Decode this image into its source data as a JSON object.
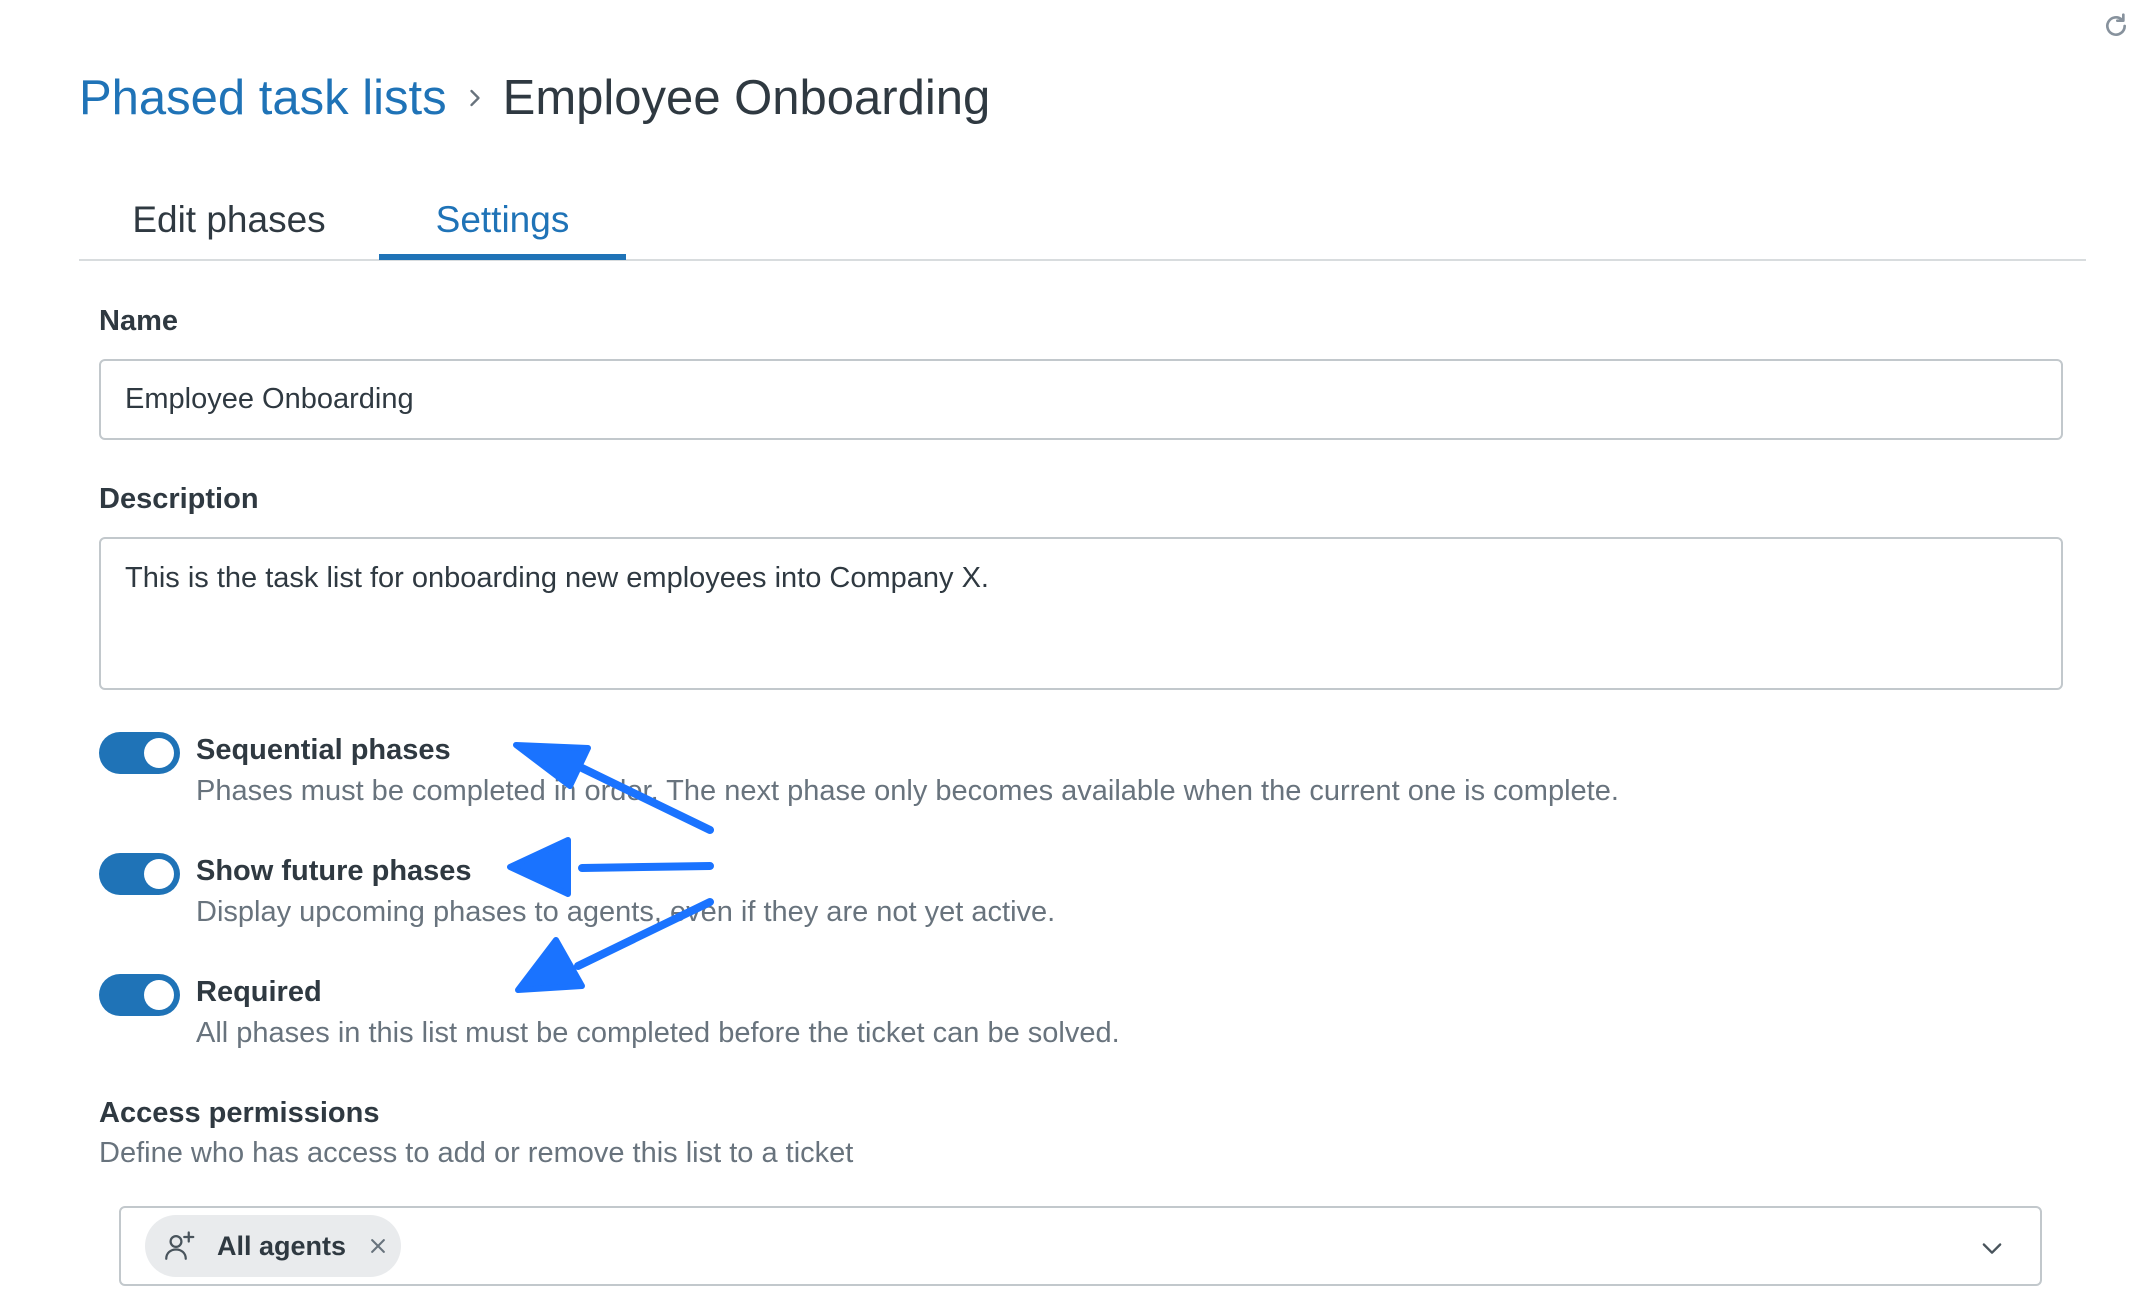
{
  "breadcrumb": {
    "parent": "Phased task lists",
    "current": "Employee Onboarding"
  },
  "tabs": [
    {
      "label": "Edit phases",
      "active": false
    },
    {
      "label": "Settings",
      "active": true
    }
  ],
  "form": {
    "name_label": "Name",
    "name_value": "Employee Onboarding",
    "description_label": "Description",
    "description_value": "This is the task list for onboarding new employees into Company X."
  },
  "toggles": [
    {
      "title": "Sequential phases",
      "description": "Phases must be completed in order. The next phase only becomes available when the current one is complete.",
      "on": true
    },
    {
      "title": "Show future phases",
      "description": "Display upcoming phases to agents, even if they are not yet active.",
      "on": true
    },
    {
      "title": "Required",
      "description": "All phases in this list must be completed before the ticket can be solved.",
      "on": true
    }
  ],
  "access": {
    "title": "Access permissions",
    "description": "Define who has access to add or remove this list to a ticket",
    "selected_tag": "All agents"
  },
  "icons": {
    "refresh": "refresh-icon",
    "breadcrumb_separator": "chevron-right-icon",
    "tag": "user-plus-icon",
    "tag_remove": "close-icon",
    "dropdown": "chevron-down-icon"
  },
  "colors": {
    "accent": "#1f73b7",
    "annotation_arrow": "#1a73ff",
    "text": "#2f3941",
    "muted_text": "#68737d"
  }
}
